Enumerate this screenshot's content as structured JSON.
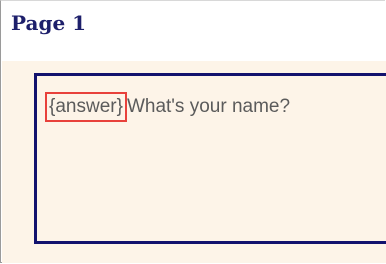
{
  "page": {
    "title": "Page 1"
  },
  "question": {
    "answer_placeholder": "{answer}",
    "text": "What's your name?"
  },
  "colors": {
    "title": "#1d1f6b",
    "body_background": "#fdf4e8",
    "block_border": "#12126e",
    "selection_highlight": "#e8413b",
    "text": "#5b5b5b"
  }
}
